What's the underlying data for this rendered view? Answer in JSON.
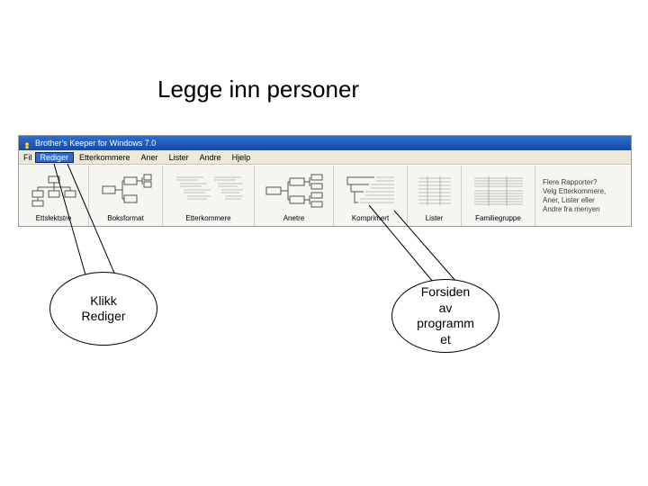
{
  "slide": {
    "title": "Legge inn personer"
  },
  "app": {
    "window_title": "Brother's Keeper for Windows 7.0",
    "menu": {
      "fil": "Fil",
      "rediger": "Rediger",
      "etterkommere": "Etterkommere",
      "aner": "Aner",
      "lister": "Lister",
      "andre": "Andre",
      "hjelp": "Hjelp"
    },
    "toolbar": {
      "ettslektstre": "Ettslektstre",
      "boksformat": "Boksformat",
      "etterkommere": "Etterkommere",
      "anetre": "Anetre",
      "komprimert": "Komprimert",
      "lister": "Lister",
      "familiegruppe": "Familiegruppe"
    },
    "hint": {
      "l1": "Flere Rapporter?",
      "l2": "Velg Etterkommere,",
      "l3": "Aner, Lister eller",
      "l4": "Andre fra menyen"
    }
  },
  "callouts": {
    "klikk": {
      "line1": "Klikk",
      "line2": "Rediger"
    },
    "forsiden": {
      "line1": "Forsiden",
      "line2": "av",
      "line3": "programm",
      "line4": "et"
    }
  },
  "icons": {
    "app_icon": "app-icon"
  },
  "colors": {
    "titlebar": "#1a4aa0",
    "menubg": "#ece9d8",
    "selected": "#316ac5"
  }
}
